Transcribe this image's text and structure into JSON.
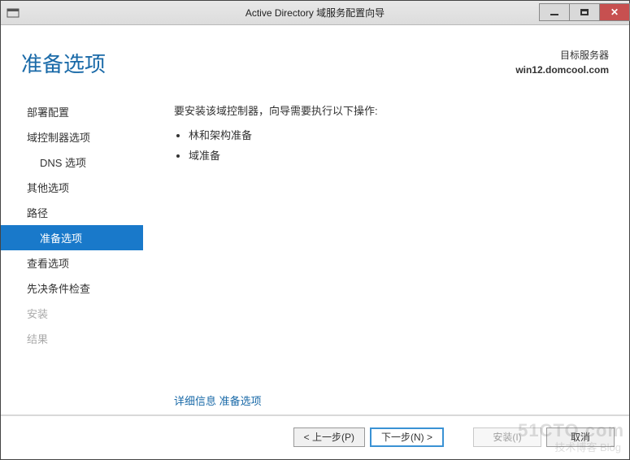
{
  "window": {
    "title": "Active Directory 域服务配置向导"
  },
  "header": {
    "page_title": "准备选项",
    "target_label": "目标服务器",
    "target_value": "win12.domcool.com"
  },
  "sidebar": {
    "items": [
      {
        "label": "部署配置",
        "indent": "top"
      },
      {
        "label": "域控制器选项",
        "indent": "top"
      },
      {
        "label": "DNS 选项",
        "indent": "sub"
      },
      {
        "label": "其他选项",
        "indent": "top"
      },
      {
        "label": "路径",
        "indent": "top"
      },
      {
        "label": "准备选项",
        "indent": "sub",
        "active": true
      },
      {
        "label": "查看选项",
        "indent": "top"
      },
      {
        "label": "先决条件检查",
        "indent": "top"
      },
      {
        "label": "安装",
        "indent": "top",
        "disabled": true
      },
      {
        "label": "结果",
        "indent": "top",
        "disabled": true
      }
    ]
  },
  "main": {
    "intro": "要安装该域控制器，向导需要执行以下操作:",
    "bullets": [
      "林和架构准备",
      "域准备"
    ],
    "more_info_prefix": "详细信息",
    "more_info_link": "准备选项"
  },
  "footer": {
    "prev": "< 上一步(P)",
    "next": "下一步(N) >",
    "install": "安装(I)",
    "cancel": "取消"
  },
  "watermark": {
    "line1": "51CTO.com",
    "line2": "技术博客 Blog"
  }
}
